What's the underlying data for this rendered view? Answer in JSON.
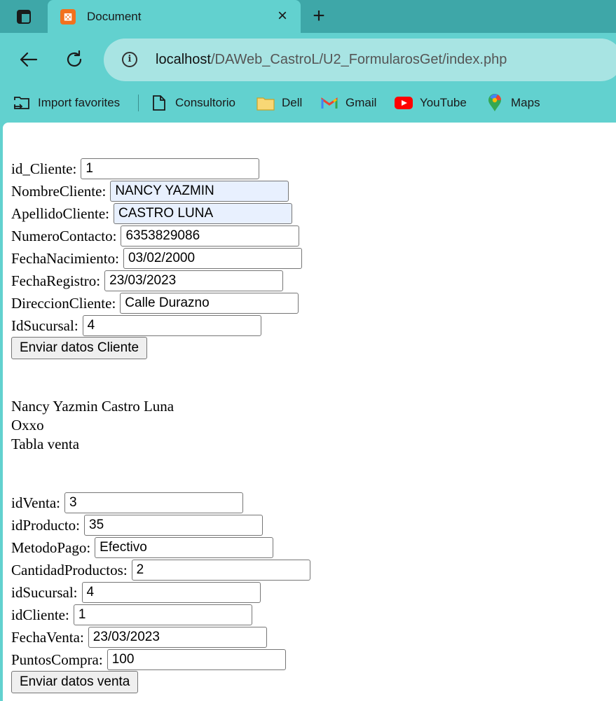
{
  "browser": {
    "tab_title": "Document",
    "url_host": "localhost",
    "url_path": "/DAWeb_CastroL/U2_FormularosGet/index.php",
    "bookmarks": [
      "Import favorites",
      "Consultorio",
      "Dell",
      "Gmail",
      "YouTube",
      "Maps"
    ]
  },
  "cliente_form": {
    "fields": [
      {
        "label": "id_Cliente:",
        "value": "1"
      },
      {
        "label": "NombreCliente:",
        "value": "NANCY YAZMIN"
      },
      {
        "label": "ApellidoCliente:",
        "value": "CASTRO LUNA"
      },
      {
        "label": "NumeroContacto:",
        "value": "6353829086"
      },
      {
        "label": "FechaNacimiento:",
        "value": "03/02/2000"
      },
      {
        "label": "FechaRegistro:",
        "value": "23/03/2023"
      },
      {
        "label": "DireccionCliente:",
        "value": "Calle Durazno"
      },
      {
        "label": "IdSucursal:",
        "value": "4"
      }
    ],
    "submit_label": "Enviar datos Cliente"
  },
  "output": {
    "nombre": "Nancy Yazmin Castro Luna",
    "sucursal": "Oxxo",
    "tabla": "Tabla venta"
  },
  "venta_form": {
    "fields": [
      {
        "label": "idVenta:",
        "value": "3"
      },
      {
        "label": "idProducto:",
        "value": "35"
      },
      {
        "label": "MetodoPago:",
        "value": "Efectivo"
      },
      {
        "label": "CantidadProductos:",
        "value": "2"
      },
      {
        "label": "idSucursal:",
        "value": "4"
      },
      {
        "label": "idCliente:",
        "value": "1"
      },
      {
        "label": "FechaVenta:",
        "value": "23/03/2023"
      },
      {
        "label": "PuntosCompra:",
        "value": "100"
      }
    ],
    "submit_label": "Enviar datos venta"
  },
  "colors": {
    "tabstrip": "#3ea7a8",
    "toolbar": "#62d1cf",
    "omnibox": "#a8e4e3",
    "autofill": "#e8f0fe"
  }
}
